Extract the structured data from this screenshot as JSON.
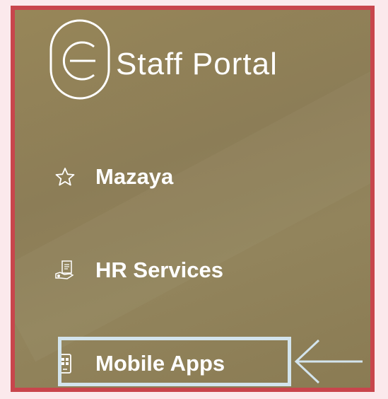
{
  "app": {
    "title": "Staff Portal",
    "logo_icon": "staff-portal-logo"
  },
  "nav": {
    "items": [
      {
        "label": "Mazaya",
        "icon": "star-icon"
      },
      {
        "label": "HR Services",
        "icon": "hr-services-icon"
      },
      {
        "label": "Mobile Apps",
        "icon": "mobile-phone-icon"
      }
    ]
  },
  "annotation": {
    "highlight_color": "#d3e4ed",
    "frame_color": "#c8454c",
    "arrow": "left-arrow"
  },
  "colors": {
    "panel": "#8f7f56",
    "text": "#ffffff"
  }
}
